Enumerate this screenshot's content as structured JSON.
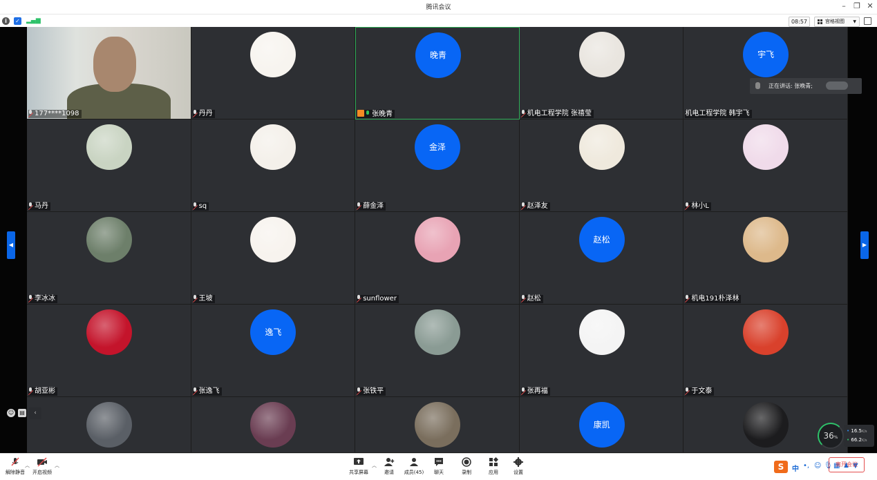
{
  "window": {
    "title": "腾讯会议"
  },
  "infobar": {
    "time": "08:57",
    "view_label": "宫格视图"
  },
  "speaking": {
    "label": "正在讲话: 张晚青;"
  },
  "grid": {
    "rows": 5,
    "cols": 5,
    "participants": [
      {
        "name": "177****1098",
        "avatar": "video"
      },
      {
        "name": "丹丹",
        "avatar": "photo",
        "color": "#f7f4ef"
      },
      {
        "name": "张晚青",
        "avatar": "initial",
        "initial": "晚青",
        "speaking": true,
        "host": true,
        "mic_on": true
      },
      {
        "name": "机电工程学院 张禧莹",
        "avatar": "photo",
        "color": "#e9e5df"
      },
      {
        "name": "机电工程学院 韩宇飞",
        "avatar": "initial",
        "initial": "宇飞",
        "mic_hidden": true
      },
      {
        "name": "马丹",
        "avatar": "photo",
        "color": "#c9d4c2"
      },
      {
        "name": "sq",
        "avatar": "photo",
        "color": "#f4f0ea"
      },
      {
        "name": "薛金泽",
        "avatar": "initial",
        "initial": "金泽"
      },
      {
        "name": "赵泽友",
        "avatar": "photo",
        "color": "#efe9dd"
      },
      {
        "name": "林小L",
        "avatar": "photo",
        "color": "#f0dbea"
      },
      {
        "name": "李冰冰",
        "avatar": "photo",
        "color": "#6d7f6a"
      },
      {
        "name": "王坡",
        "avatar": "photo",
        "color": "#f7f3ee"
      },
      {
        "name": "sunflower",
        "avatar": "photo",
        "color": "#e8a3b4"
      },
      {
        "name": "赵松",
        "avatar": "initial",
        "initial": "赵松"
      },
      {
        "name": "机电191朴泽林",
        "avatar": "photo",
        "color": "#ddb98b"
      },
      {
        "name": "胡亚彬",
        "avatar": "photo",
        "color": "#c4142b"
      },
      {
        "name": "张逸飞",
        "avatar": "initial",
        "initial": "逸飞"
      },
      {
        "name": "张铁平",
        "avatar": "photo",
        "color": "#8a9b94"
      },
      {
        "name": "张再福",
        "avatar": "photo",
        "color": "#f4f4f4"
      },
      {
        "name": "于文泰",
        "avatar": "photo",
        "color": "#d9412c"
      },
      {
        "name": "",
        "avatar": "photo",
        "color": "#5a5f66"
      },
      {
        "name": "",
        "avatar": "photo",
        "color": "#6a3d52"
      },
      {
        "name": "",
        "avatar": "photo",
        "color": "#7a6e5d"
      },
      {
        "name": "",
        "avatar": "initial",
        "initial": "康凯"
      },
      {
        "name": "",
        "avatar": "photo",
        "color": "#1c1c1e"
      }
    ]
  },
  "network": {
    "percent": "36",
    "percent_unit": "%",
    "up": "16.5",
    "down": "66.2",
    "rate_unit": "K/s"
  },
  "toolbar": {
    "left": [
      {
        "id": "unmute",
        "label": "解除静音"
      },
      {
        "id": "video",
        "label": "开启视频"
      }
    ],
    "center": [
      {
        "id": "share",
        "label": "共享屏幕"
      },
      {
        "id": "invite",
        "label": "邀请"
      },
      {
        "id": "members",
        "label": "成员(45)"
      },
      {
        "id": "chat",
        "label": "聊天"
      },
      {
        "id": "record",
        "label": "录制"
      },
      {
        "id": "apps",
        "label": "应用"
      },
      {
        "id": "settings",
        "label": "设置"
      }
    ],
    "end_label": "离开会议",
    "ime_label": "中"
  },
  "colors": {
    "accent": "#0866f5",
    "speaking_border": "#2eaf57",
    "danger": "#e34d4d",
    "host": "#f58b23"
  }
}
